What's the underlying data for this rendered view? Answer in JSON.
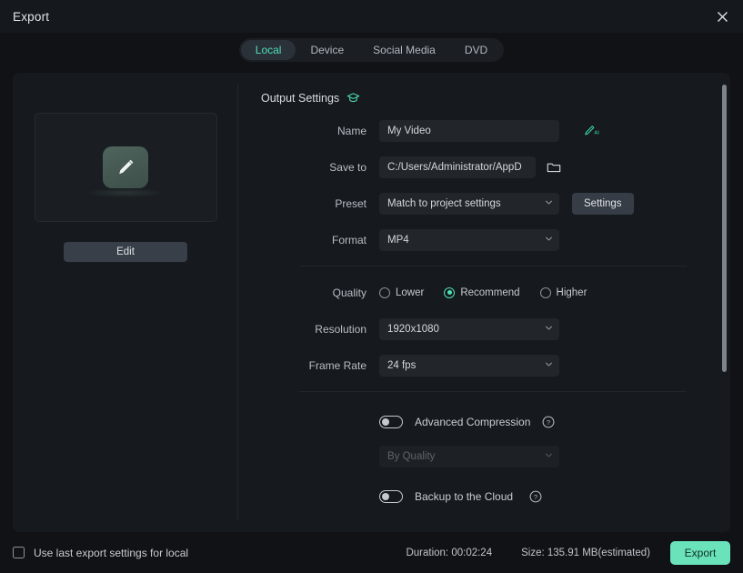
{
  "window": {
    "title": "Export",
    "close_icon": "close-icon"
  },
  "tabs": [
    {
      "label": "Local",
      "active": true
    },
    {
      "label": "Device",
      "active": false
    },
    {
      "label": "Social Media",
      "active": false
    },
    {
      "label": "DVD",
      "active": false
    }
  ],
  "preview": {
    "thumb_icon": "pencil-edit-icon",
    "edit_label": "Edit"
  },
  "output_settings": {
    "heading": "Output Settings",
    "heading_icon": "graduation-cap-icon",
    "name": {
      "label": "Name",
      "value": "My Video",
      "ai_icon": "ai-pencil-icon"
    },
    "save_to": {
      "label": "Save to",
      "value": "C:/Users/Administrator/AppD",
      "browse_icon": "folder-icon"
    },
    "preset": {
      "label": "Preset",
      "value": "Match to project settings",
      "settings_button": "Settings"
    },
    "format": {
      "label": "Format",
      "value": "MP4"
    },
    "quality": {
      "label": "Quality",
      "options": [
        {
          "label": "Lower",
          "selected": false
        },
        {
          "label": "Recommend",
          "selected": true
        },
        {
          "label": "Higher",
          "selected": false
        }
      ]
    },
    "resolution": {
      "label": "Resolution",
      "value": "1920x1080"
    },
    "frame_rate": {
      "label": "Frame Rate",
      "value": "24 fps"
    },
    "advanced_compression": {
      "label": "Advanced Compression",
      "enabled": false,
      "help_icon": "question-mark-icon",
      "mode": {
        "value": "By Quality",
        "disabled": true
      }
    },
    "backup_cloud": {
      "label": "Backup to the Cloud",
      "enabled": false,
      "help_icon": "question-mark-icon"
    }
  },
  "footer": {
    "use_last_settings": {
      "label": "Use last export settings for local",
      "checked": false
    },
    "duration": "Duration: 00:02:24",
    "size": "Size: 135.91 MB(estimated)",
    "export_label": "Export"
  },
  "colors": {
    "accent": "#4ce0b3",
    "export_button": "#6ae3bb",
    "window_bg": "#101215",
    "card_bg": "#16191d",
    "field_bg": "#22262b"
  }
}
